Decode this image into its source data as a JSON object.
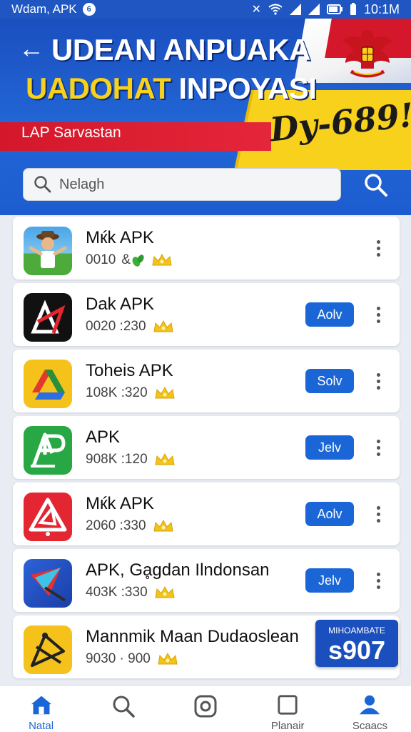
{
  "status_bar": {
    "carrier": "Wdam, APK",
    "time": "10:1M"
  },
  "header": {
    "back_label": "←",
    "title_line1": "UDEAN ANPUAKA",
    "title_line2_accent": "UADOHAT",
    "title_line2_rest": " INPOYASI",
    "subtitle": "LAP Sarvastan",
    "price_tag": "Dy-689!"
  },
  "search": {
    "placeholder": "Nelagh"
  },
  "apps": [
    {
      "name": "Mќk APK",
      "meta": "0010",
      "meta_extra": "&",
      "button": "",
      "icon": "person-icon"
    },
    {
      "name": "Dak APK",
      "meta": "0020 :230",
      "meta_extra": "",
      "button": "Aolv",
      "icon": "triangle-logo-icon"
    },
    {
      "name": "Toheis APK",
      "meta": "108K :320",
      "meta_extra": "",
      "button": "Solv",
      "icon": "drive-logo-icon"
    },
    {
      "name": "APK",
      "meta": "908K :120",
      "meta_extra": "",
      "button": "Jelv",
      "icon": "ap-logo-icon"
    },
    {
      "name": "Mќk APK",
      "meta": "2060 :330",
      "meta_extra": "",
      "button": "Aolv",
      "icon": "alert-logo-icon"
    },
    {
      "name": "APK, Gḁgdan Ilndonsan",
      "meta": "403K :330",
      "meta_extra": "",
      "button": "Jelv",
      "icon": "send-logo-icon"
    },
    {
      "name": "Mannmik Maan Dudaoslean",
      "meta": "9030 · 900",
      "meta_extra": "",
      "button": "",
      "icon": "compass-logo-icon"
    }
  ],
  "promo": {
    "label": "MIHOAMBATE",
    "value": "s907"
  },
  "bottom_nav": [
    {
      "label": "Natal",
      "icon": "home-icon"
    },
    {
      "label": "",
      "icon": "search-icon"
    },
    {
      "label": "",
      "icon": "camera-icon"
    },
    {
      "label": "Planair",
      "icon": "square-icon"
    },
    {
      "label": "Scaacs",
      "icon": "profile-icon"
    }
  ],
  "colors": {
    "primary_blue": "#1b66d6",
    "header_blue": "#1f56c2",
    "accent_yellow": "#f7d11c",
    "ribbon_red": "#d4172a"
  }
}
